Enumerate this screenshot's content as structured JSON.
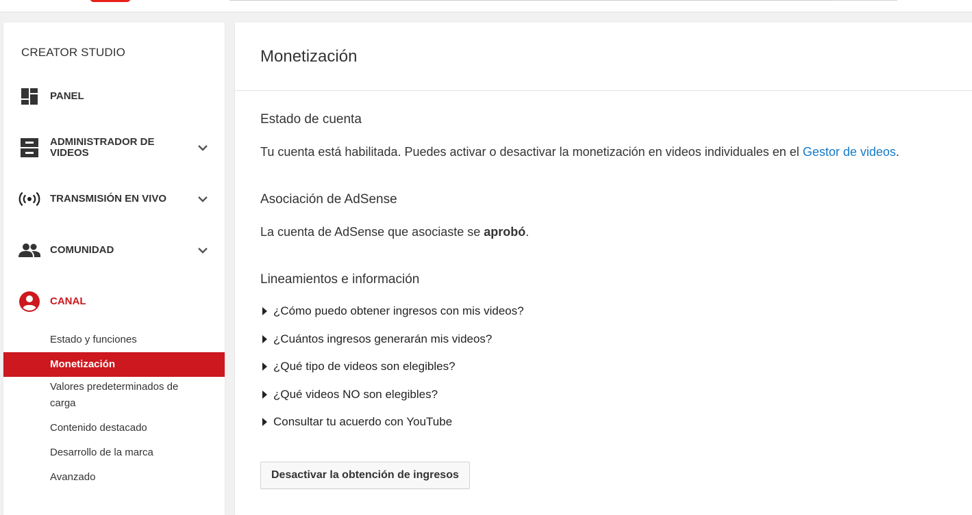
{
  "colors": {
    "accent_red": "#cc181e",
    "link_blue": "#167ac6"
  },
  "sidebar": {
    "title": "CREATOR STUDIO",
    "items": [
      {
        "label": "PANEL",
        "icon": "dashboard-icon"
      },
      {
        "label": "ADMINISTRADOR DE VIDEOS",
        "icon": "video-manager-icon"
      },
      {
        "label": "TRANSMISIÓN EN VIVO",
        "icon": "live-broadcast-icon"
      },
      {
        "label": "COMUNIDAD",
        "icon": "community-icon"
      },
      {
        "label": "CANAL",
        "icon": "channel-account-icon"
      }
    ],
    "canal_subitems": [
      "Estado y funciones",
      "Monetización",
      "Valores predeterminados de carga",
      "Contenido destacado",
      "Desarrollo de la marca",
      "Avanzado"
    ]
  },
  "main": {
    "title": "Monetización",
    "account_status": {
      "heading": "Estado de cuenta",
      "text": "Tu cuenta está habilitada. Puedes activar o desactivar la monetización en videos individuales en el ",
      "link": "Gestor de videos",
      "suffix": "."
    },
    "adsense": {
      "heading": "Asociación de AdSense",
      "text_before": "La cuenta de AdSense que asociaste se ",
      "text_bold": "aprobó",
      "text_after": "."
    },
    "guidelines": {
      "heading": "Lineamientos e información",
      "items": [
        "¿Cómo puedo obtener ingresos con mis videos?",
        "¿Cuántos ingresos generarán mis videos?",
        "¿Qué tipo de videos son elegibles?",
        "¿Qué videos NO son elegibles?",
        "Consultar tu acuerdo con YouTube"
      ]
    },
    "disable_button": "Desactivar la obtención de ingresos"
  }
}
